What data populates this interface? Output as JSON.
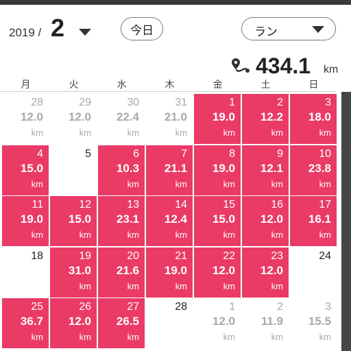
{
  "header": {
    "year": "2019 /",
    "month": "2",
    "today_label": "今日",
    "activity": "ラン"
  },
  "summary": {
    "total": "434.1",
    "unit": "km"
  },
  "weekdays": [
    "月",
    "火",
    "水",
    "木",
    "金",
    "土",
    "日"
  ],
  "colors": {
    "run": "#ea3a66",
    "outside": "#a8a8a8",
    "scrollbar": "#45454a"
  },
  "weeks": [
    [
      {
        "day": "28",
        "dist": "12.0",
        "unit": "km",
        "state": "outside"
      },
      {
        "day": "29",
        "dist": "12.0",
        "unit": "km",
        "state": "outside"
      },
      {
        "day": "30",
        "dist": "22.4",
        "unit": "km",
        "state": "outside"
      },
      {
        "day": "31",
        "dist": "21.0",
        "unit": "km",
        "state": "outside"
      },
      {
        "day": "1",
        "dist": "19.0",
        "unit": "km",
        "state": "run"
      },
      {
        "day": "2",
        "dist": "12.2",
        "unit": "km",
        "state": "run"
      },
      {
        "day": "3",
        "dist": "18.0",
        "unit": "km",
        "state": "run"
      }
    ],
    [
      {
        "day": "4",
        "dist": "15.0",
        "unit": "km",
        "state": "run"
      },
      {
        "day": "5",
        "dist": "",
        "unit": "",
        "state": "blank"
      },
      {
        "day": "6",
        "dist": "10.3",
        "unit": "km",
        "state": "run"
      },
      {
        "day": "7",
        "dist": "21.1",
        "unit": "km",
        "state": "run"
      },
      {
        "day": "8",
        "dist": "19.0",
        "unit": "km",
        "state": "run"
      },
      {
        "day": "9",
        "dist": "12.1",
        "unit": "km",
        "state": "run"
      },
      {
        "day": "10",
        "dist": "23.8",
        "unit": "km",
        "state": "run"
      }
    ],
    [
      {
        "day": "11",
        "dist": "19.0",
        "unit": "km",
        "state": "run"
      },
      {
        "day": "12",
        "dist": "15.0",
        "unit": "km",
        "state": "run"
      },
      {
        "day": "13",
        "dist": "23.1",
        "unit": "km",
        "state": "run"
      },
      {
        "day": "14",
        "dist": "12.4",
        "unit": "km",
        "state": "run"
      },
      {
        "day": "15",
        "dist": "15.0",
        "unit": "km",
        "state": "run"
      },
      {
        "day": "16",
        "dist": "12.0",
        "unit": "km",
        "state": "run"
      },
      {
        "day": "17",
        "dist": "16.1",
        "unit": "km",
        "state": "run"
      }
    ],
    [
      {
        "day": "18",
        "dist": "",
        "unit": "",
        "state": "blank"
      },
      {
        "day": "19",
        "dist": "31.0",
        "unit": "km",
        "state": "run"
      },
      {
        "day": "20",
        "dist": "21.6",
        "unit": "km",
        "state": "run"
      },
      {
        "day": "21",
        "dist": "19.0",
        "unit": "km",
        "state": "run"
      },
      {
        "day": "22",
        "dist": "12.0",
        "unit": "km",
        "state": "run"
      },
      {
        "day": "23",
        "dist": "12.0",
        "unit": "km",
        "state": "run"
      },
      {
        "day": "24",
        "dist": "",
        "unit": "",
        "state": "blank"
      }
    ],
    [
      {
        "day": "25",
        "dist": "36.7",
        "unit": "km",
        "state": "run"
      },
      {
        "day": "26",
        "dist": "12.0",
        "unit": "km",
        "state": "run"
      },
      {
        "day": "27",
        "dist": "26.5",
        "unit": "km",
        "state": "run"
      },
      {
        "day": "28",
        "dist": "",
        "unit": "",
        "state": "blank"
      },
      {
        "day": "1",
        "dist": "12.0",
        "unit": "km",
        "state": "outside"
      },
      {
        "day": "2",
        "dist": "11.9",
        "unit": "km",
        "state": "outside"
      },
      {
        "day": "3",
        "dist": "15.5",
        "unit": "km",
        "state": "outside"
      }
    ]
  ]
}
